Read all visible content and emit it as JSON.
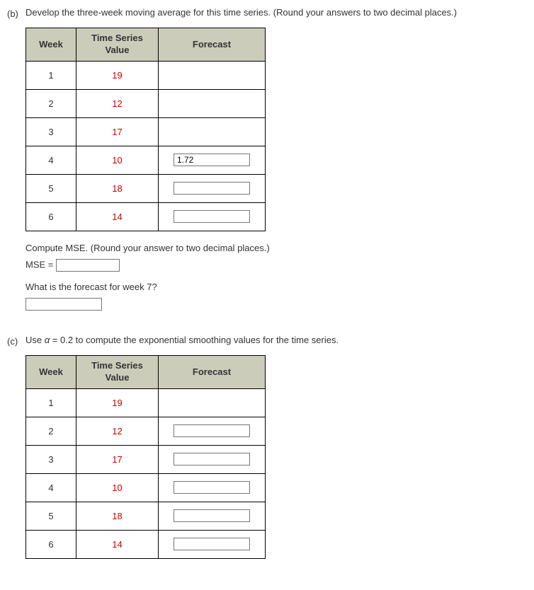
{
  "part_b": {
    "label": "(b)",
    "instruction": "Develop the three-week moving average for this time series. (Round your answers to two decimal places.)",
    "table": {
      "headers": {
        "week": "Week",
        "value": "Time Series\nValue",
        "forecast": "Forecast"
      },
      "rows": [
        {
          "week": "1",
          "value": "19",
          "forecast_input": null
        },
        {
          "week": "2",
          "value": "12",
          "forecast_input": null
        },
        {
          "week": "3",
          "value": "17",
          "forecast_input": null
        },
        {
          "week": "4",
          "value": "10",
          "forecast_input": "1.72"
        },
        {
          "week": "5",
          "value": "18",
          "forecast_input": ""
        },
        {
          "week": "6",
          "value": "14",
          "forecast_input": ""
        }
      ]
    },
    "mse_instruction": "Compute MSE. (Round your answer to two decimal places.)",
    "mse_label": "MSE = ",
    "mse_value": "",
    "week7_question": "What is the forecast for week 7?",
    "week7_value": ""
  },
  "part_c": {
    "label": "(c)",
    "instruction_pre": "Use ",
    "instruction_alpha": "α",
    "instruction_eq": " = 0.2 to compute the exponential smoothing values for the time series.",
    "table": {
      "headers": {
        "week": "Week",
        "value": "Time Series\nValue",
        "forecast": "Forecast"
      },
      "rows": [
        {
          "week": "1",
          "value": "19",
          "forecast_input": null
        },
        {
          "week": "2",
          "value": "12",
          "forecast_input": ""
        },
        {
          "week": "3",
          "value": "17",
          "forecast_input": ""
        },
        {
          "week": "4",
          "value": "10",
          "forecast_input": ""
        },
        {
          "week": "5",
          "value": "18",
          "forecast_input": ""
        },
        {
          "week": "6",
          "value": "14",
          "forecast_input": ""
        }
      ]
    }
  }
}
